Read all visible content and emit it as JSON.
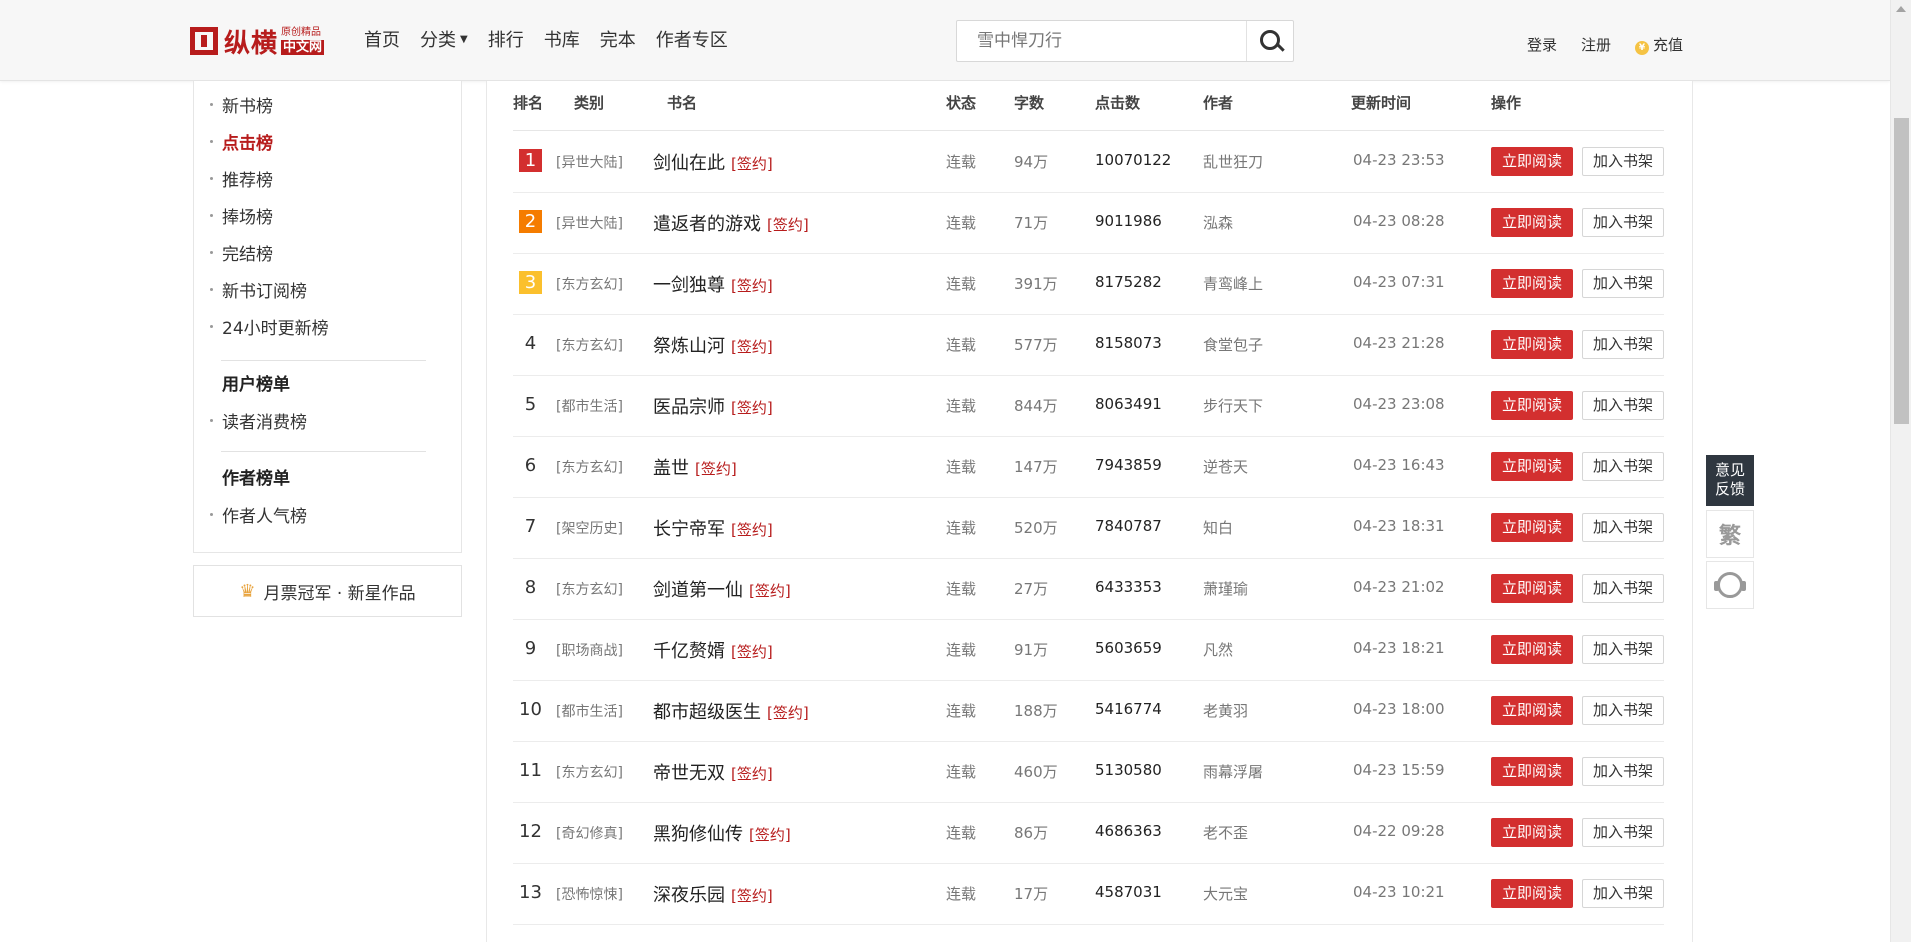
{
  "header": {
    "logo": {
      "main": "纵横",
      "top": "原创精品",
      "bottom": "中文网"
    },
    "nav": [
      {
        "label": "首页"
      },
      {
        "label": "分类",
        "has_dropdown": true
      },
      {
        "label": "排行"
      },
      {
        "label": "书库"
      },
      {
        "label": "完本"
      },
      {
        "label": "作者专区"
      }
    ],
    "search": {
      "placeholder": "雪中悍刀行"
    },
    "login": "登录",
    "register": "注册",
    "recharge": "充值"
  },
  "sidebar": {
    "rank_items": [
      {
        "label": "新书榜",
        "active": false
      },
      {
        "label": "点击榜",
        "active": true
      },
      {
        "label": "推荐榜",
        "active": false
      },
      {
        "label": "捧场榜",
        "active": false
      },
      {
        "label": "完结榜",
        "active": false
      },
      {
        "label": "新书订阅榜",
        "active": false
      },
      {
        "label": "24小时更新榜",
        "active": false
      }
    ],
    "user_section": {
      "heading": "用户榜单",
      "items": [
        {
          "label": "读者消费榜"
        }
      ]
    },
    "author_section": {
      "heading": "作者榜单",
      "items": [
        {
          "label": "作者人气榜"
        }
      ]
    },
    "monthly_box": "月票冠军 · 新星作品"
  },
  "table": {
    "headers": [
      "排名",
      "类别",
      "书名",
      "状态",
      "字数",
      "点击数",
      "作者",
      "更新时间",
      "操作"
    ],
    "sign_label": "[签约]",
    "read_label": "立即阅读",
    "shelf_label": "加入书架",
    "rows": [
      {
        "rank": "1",
        "category": "[异世大陆]",
        "title": "剑仙在此",
        "status": "连载",
        "words": "94万",
        "clicks": "10070122",
        "author": "乱世狂刀",
        "updated": "04-23 23:53"
      },
      {
        "rank": "2",
        "category": "[异世大陆]",
        "title": "遣返者的游戏",
        "status": "连载",
        "words": "71万",
        "clicks": "9011986",
        "author": "泓森",
        "updated": "04-23 08:28"
      },
      {
        "rank": "3",
        "category": "[东方玄幻]",
        "title": "一剑独尊",
        "status": "连载",
        "words": "391万",
        "clicks": "8175282",
        "author": "青鸾峰上",
        "updated": "04-23 07:31"
      },
      {
        "rank": "4",
        "category": "[东方玄幻]",
        "title": "祭炼山河",
        "status": "连载",
        "words": "577万",
        "clicks": "8158073",
        "author": "食堂包子",
        "updated": "04-23 21:28"
      },
      {
        "rank": "5",
        "category": "[都市生活]",
        "title": "医品宗师",
        "status": "连载",
        "words": "844万",
        "clicks": "8063491",
        "author": "步行天下",
        "updated": "04-23 23:08"
      },
      {
        "rank": "6",
        "category": "[东方玄幻]",
        "title": "盖世",
        "status": "连载",
        "words": "147万",
        "clicks": "7943859",
        "author": "逆苍天",
        "updated": "04-23 16:43"
      },
      {
        "rank": "7",
        "category": "[架空历史]",
        "title": "长宁帝军",
        "status": "连载",
        "words": "520万",
        "clicks": "7840787",
        "author": "知白",
        "updated": "04-23 18:31"
      },
      {
        "rank": "8",
        "category": "[东方玄幻]",
        "title": "剑道第一仙",
        "status": "连载",
        "words": "27万",
        "clicks": "6433353",
        "author": "萧瑾瑜",
        "updated": "04-23 21:02"
      },
      {
        "rank": "9",
        "category": "[职场商战]",
        "title": "千亿赘婿",
        "status": "连载",
        "words": "91万",
        "clicks": "5603659",
        "author": "凡然",
        "updated": "04-23 18:21"
      },
      {
        "rank": "10",
        "category": "[都市生活]",
        "title": "都市超级医生",
        "status": "连载",
        "words": "188万",
        "clicks": "5416774",
        "author": "老黄羽",
        "updated": "04-23 18:00"
      },
      {
        "rank": "11",
        "category": "[东方玄幻]",
        "title": "帝世无双",
        "status": "连载",
        "words": "460万",
        "clicks": "5130580",
        "author": "雨幕浮屠",
        "updated": "04-23 15:59"
      },
      {
        "rank": "12",
        "category": "[奇幻修真]",
        "title": "黑狗修仙传",
        "status": "连载",
        "words": "86万",
        "clicks": "4686363",
        "author": "老不歪",
        "updated": "04-22 09:28"
      },
      {
        "rank": "13",
        "category": "[恐怖惊悚]",
        "title": "深夜乐园",
        "status": "连载",
        "words": "17万",
        "clicks": "4587031",
        "author": "大元宝",
        "updated": "04-23 10:21"
      }
    ]
  },
  "floating": {
    "feedback_line1": "意见",
    "feedback_line2": "反馈",
    "traditional": "繁"
  },
  "colors": {
    "brand": "#b71c1c",
    "read_button": "#d32f2f",
    "rank1": "#d32f2f",
    "rank2": "#f57c00",
    "rank3": "#fbc02d"
  }
}
